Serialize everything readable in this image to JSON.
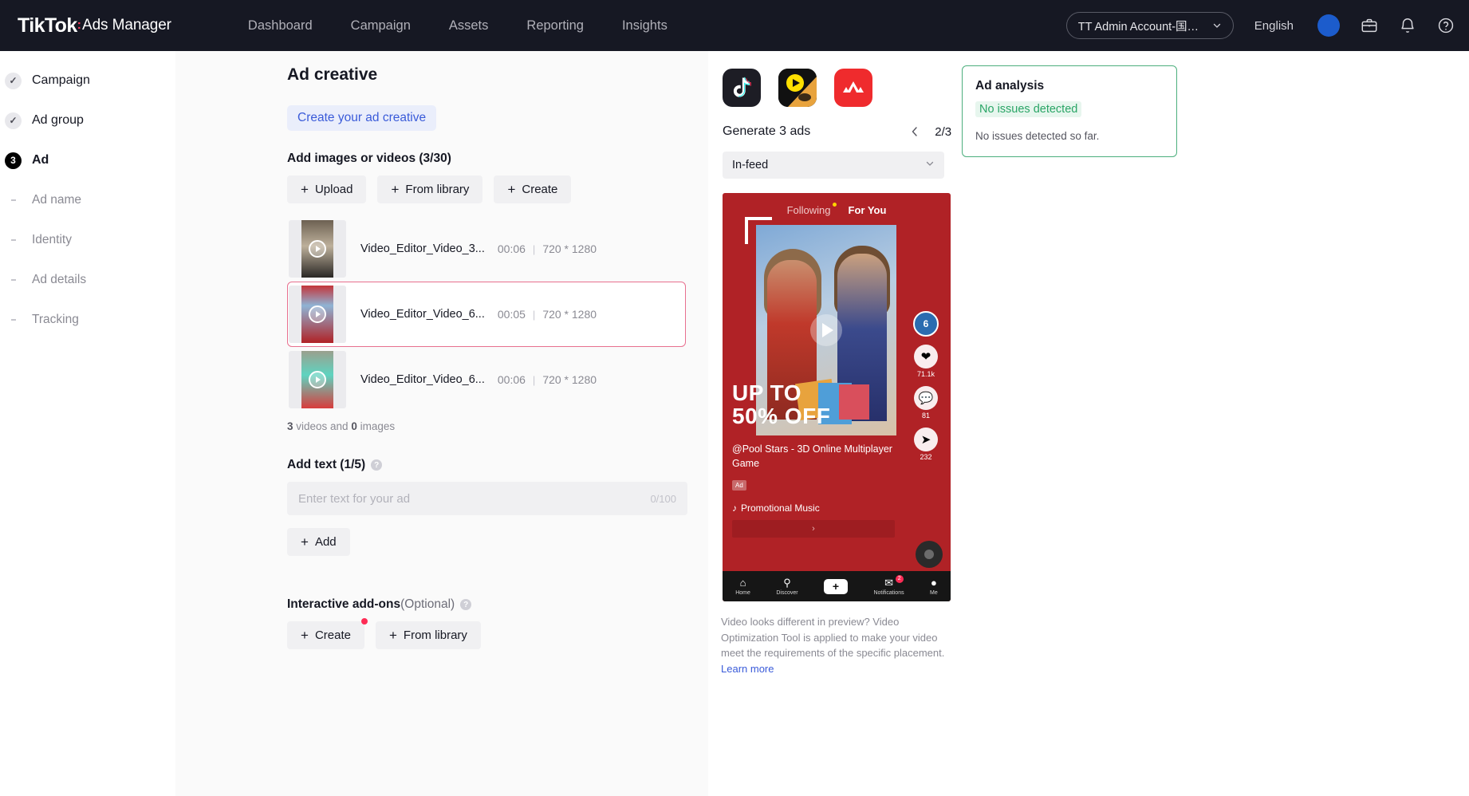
{
  "topnav": {
    "brand_name": "TikTok",
    "brand_colon": ":",
    "brand_sub": "Ads Manager",
    "links": [
      {
        "label": "Dashboard",
        "name": "nav-dashboard"
      },
      {
        "label": "Campaign",
        "name": "nav-campaign"
      },
      {
        "label": "Assets",
        "name": "nav-assets"
      },
      {
        "label": "Reporting",
        "name": "nav-reporting"
      },
      {
        "label": "Insights",
        "name": "nav-insights"
      }
    ],
    "account": "TT Admin Account-国际...",
    "language": "English",
    "icons": [
      "avatar",
      "briefcase-icon",
      "bell-icon",
      "help-icon"
    ]
  },
  "sidebar": {
    "steps": [
      {
        "label": "Campaign",
        "badge": "✓",
        "state": "done"
      },
      {
        "label": "Ad group",
        "badge": "✓",
        "state": "done"
      },
      {
        "label": "Ad",
        "badge": "3",
        "state": "active"
      }
    ],
    "subitems": [
      {
        "label": "Ad name"
      },
      {
        "label": "Identity"
      },
      {
        "label": "Ad details"
      },
      {
        "label": "Tracking"
      }
    ]
  },
  "main": {
    "page_title": "Ad creative",
    "creative_tab": "Create your ad creative",
    "media_section_title": "Add images or videos (3/30)",
    "media_buttons": [
      {
        "label": "Upload",
        "name": "upload-button"
      },
      {
        "label": "From library",
        "name": "from-library-button"
      },
      {
        "label": "Create",
        "name": "create-button"
      }
    ],
    "media_items": [
      {
        "name": "Video_Editor_Video_3...",
        "duration": "00:06",
        "dimensions": "720 * 1280",
        "selected": false
      },
      {
        "name": "Video_Editor_Video_6...",
        "duration": "00:05",
        "dimensions": "720 * 1280",
        "selected": true
      },
      {
        "name": "Video_Editor_Video_6...",
        "duration": "00:06",
        "dimensions": "720 * 1280",
        "selected": false
      }
    ],
    "media_separator": "|",
    "count_videos": "3",
    "count_videos_suffix": " videos and ",
    "count_images": "0",
    "count_images_suffix": " images",
    "text_section_title": "Add text (1/5)",
    "text_placeholder": "Enter text for your ad",
    "text_counter": "0/100",
    "add_text_button": "Add",
    "addons_title": "Interactive add-ons",
    "addons_optional": "(Optional)",
    "addons_buttons": [
      {
        "label": "Create",
        "name": "addons-create-button",
        "badge": true
      },
      {
        "label": "From library",
        "name": "addons-from-library-button",
        "badge": false
      }
    ]
  },
  "preview": {
    "platforms": [
      {
        "name": "tiktok-platform-icon",
        "selected": true
      },
      {
        "name": "pangle-platform-icon",
        "selected": false
      },
      {
        "name": "helo-platform-icon",
        "selected": false
      }
    ],
    "generate_label": "Generate 3 ads",
    "pager": "2/3",
    "placement": "In-feed",
    "phone": {
      "tab_following": "Following",
      "tab_foryou": "For You",
      "promo_line1": "UP TO",
      "promo_line2": "50% OFF",
      "handle": "@Pool Stars - 3D Online Multiplayer Game",
      "ad_badge": "Ad",
      "music": "Promotional Music",
      "cta": "›",
      "avatar_initial": "6",
      "likes": "71.1k",
      "comments": "81",
      "shares": "232",
      "navbar": [
        {
          "glyph": "⌂",
          "label": "Home"
        },
        {
          "glyph": "⚲",
          "label": "Discover"
        },
        {
          "glyph": "+",
          "label": ""
        },
        {
          "glyph": "✉",
          "label": "Notifications",
          "badge": "2"
        },
        {
          "glyph": "●",
          "label": "Me"
        }
      ]
    },
    "disclaimer": "Video looks different in preview? Video Optimization Tool is applied to make your video meet the requirements of the specific placement. ",
    "disclaimer_link": "Learn more",
    "analysis": {
      "title": "Ad analysis",
      "status": "No issues detected",
      "body": "No issues detected so far."
    }
  },
  "colors": {
    "brand_red": "#fe2c55",
    "accent_blue": "#3a5bd9",
    "success_green": "#2aa566",
    "nav_dark": "#161823"
  }
}
